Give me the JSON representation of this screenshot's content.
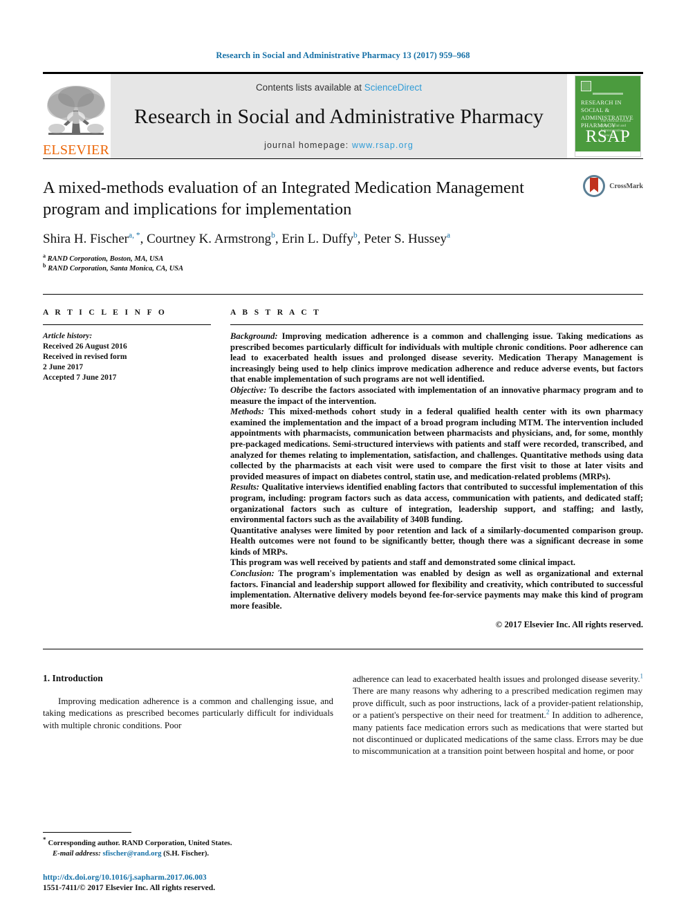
{
  "running_head": "Research in Social and Administrative Pharmacy 13 (2017) 959–968",
  "masthead": {
    "publisher_logo_text": "ELSEVIER",
    "contents_prefix": "Contents lists available at ",
    "contents_link": "ScienceDirect",
    "journal_title": "Research in Social and Administrative Pharmacy",
    "homepage_prefix": "journal homepage: ",
    "homepage_url": "www.rsap.org",
    "cover": {
      "title_line1": "RESEARCH IN SOCIAL &",
      "title_line2": "ADMINISTRATIVE PHARMACY",
      "sub_line": "The Official Journal of the\nSocial and Administrative Sciences",
      "acronym": "RSAP"
    }
  },
  "article": {
    "title": "A mixed-methods evaluation of an Integrated Medication Management program and implications for implementation",
    "authors": [
      {
        "name": "Shira H. Fischer",
        "marks": "a, *"
      },
      {
        "name": "Courtney K. Armstrong",
        "marks": "b"
      },
      {
        "name": "Erin L. Duffy",
        "marks": "b"
      },
      {
        "name": "Peter S. Hussey",
        "marks": "a"
      }
    ],
    "affiliations": [
      {
        "mark": "a",
        "text": "RAND Corporation, Boston, MA, USA"
      },
      {
        "mark": "b",
        "text": "RAND Corporation, Santa Monica, CA, USA"
      }
    ],
    "crossmark_label": "CrossMark"
  },
  "article_info": {
    "heading": "A R T I C L E   I N F O",
    "history_label": "Article history:",
    "history": [
      "Received 26 August 2016",
      "Received in revised form",
      "2 June 2017",
      "Accepted 7 June 2017"
    ]
  },
  "abstract": {
    "heading": "A B S T R A C T",
    "paragraphs": [
      {
        "label": "Background:",
        "text": " Improving medication adherence is a common and challenging issue. Taking medications as prescribed becomes particularly difficult for individuals with multiple chronic conditions. Poor adherence can lead to exacerbated health issues and prolonged disease severity. Medication Therapy Management is increasingly being used to help clinics improve medication adherence and reduce adverse events, but factors that enable implementation of such programs are not well identified."
      },
      {
        "label": "Objective:",
        "text": " To describe the factors associated with implementation of an innovative pharmacy program and to measure the impact of the intervention."
      },
      {
        "label": "Methods:",
        "text": " This mixed-methods cohort study in a federal qualified health center with its own pharmacy examined the implementation and the impact of a broad program including MTM. The intervention included appointments with pharmacists, communication between pharmacists and physicians, and, for some, monthly pre-packaged medications. Semi-structured interviews with patients and staff were recorded, transcribed, and analyzed for themes relating to implementation, satisfaction, and challenges. Quantitative methods using data collected by the pharmacists at each visit were used to compare the first visit to those at later visits and provided measures of impact on diabetes control, statin use, and medication-related problems (MRPs)."
      },
      {
        "label": "Results:",
        "text": " Qualitative interviews identified enabling factors that contributed to successful implementation of this program, including: program factors such as data access, communication with patients, and dedicated staff; organizational factors such as culture of integration, leadership support, and staffing; and lastly, environmental factors such as the availability of 340B funding."
      },
      {
        "label": "",
        "text": "Quantitative analyses were limited by poor retention and lack of a similarly-documented comparison group. Health outcomes were not found to be significantly better, though there was a significant decrease in some kinds of MRPs."
      },
      {
        "label": "",
        "text": "This program was well received by patients and staff and demonstrated some clinical impact."
      },
      {
        "label": "Conclusion:",
        "text": " The program's implementation was enabled by design as well as organizational and external factors. Financial and leadership support allowed for flexibility and creativity, which contributed to successful implementation. Alternative delivery models beyond fee-for-service payments may make this kind of program more feasible."
      }
    ],
    "copyright": "© 2017 Elsevier Inc. All rights reserved."
  },
  "body": {
    "section_heading": "1. Introduction",
    "left_paragraph": "Improving medication adherence is a common and challenging issue, and taking medications as prescribed becomes particularly difficult for individuals with multiple chronic conditions. Poor",
    "right_paragraph_part1": "adherence can lead to exacerbated health issues and prolonged disease severity.",
    "right_ref1": "1",
    "right_paragraph_part2": " There are many reasons why adhering to a prescribed medication regimen may prove difficult, such as poor instructions, lack of a provider-patient relationship, or a patient's perspective on their need for treatment.",
    "right_ref2": "2",
    "right_paragraph_part3": " In addition to adherence, many patients face medication errors such as medications that were started but not discontinued or duplicated medications of the same class. Errors may be due to miscommunication at a transition point between hospital and home, or poor"
  },
  "footnotes": {
    "corresponding_star": "*",
    "corresponding": "Corresponding author. RAND Corporation, United States.",
    "email_label": "E-mail address:",
    "email": "sfischer@rand.org",
    "email_suffix": " (S.H. Fischer).",
    "doi": "http://dx.doi.org/10.1016/j.sapharm.2017.06.003",
    "issn_line": "1551-7411/© 2017 Elsevier Inc. All rights reserved."
  },
  "colors": {
    "link": "#1570a6",
    "sciencedirect": "#2e9bd6",
    "elsevier_orange": "#ec6608",
    "cover_green": "#4b9b3e",
    "masthead_gray": "#e6e6e6"
  }
}
